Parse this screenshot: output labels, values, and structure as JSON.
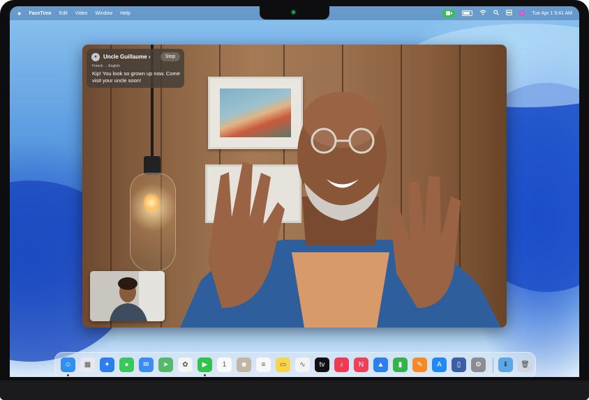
{
  "menubar": {
    "app_name": "FaceTime",
    "menus": [
      "Edit",
      "Video",
      "Window",
      "Help"
    ],
    "datetime": "Tue Apr 1  9:41 AM"
  },
  "caption": {
    "caller": "Uncle Guillaume ›",
    "stop_label": "Stop",
    "translation": "French → English",
    "message": "Kip! You look so grown up now. Come visit your uncle soon!"
  },
  "colors": {
    "accent_green": "#33c24d"
  },
  "dock": {
    "icons": [
      {
        "name": "finder-icon",
        "color": "#2f8ff5",
        "glyph": "☺"
      },
      {
        "name": "launchpad-icon",
        "color": "#e8e8ee",
        "glyph": "▦"
      },
      {
        "name": "safari-icon",
        "color": "#2a7ef0",
        "glyph": "✦"
      },
      {
        "name": "messages-icon",
        "color": "#38c759",
        "glyph": "●"
      },
      {
        "name": "mail-icon",
        "color": "#3b8cf5",
        "glyph": "✉"
      },
      {
        "name": "maps-icon",
        "color": "#55b86a",
        "glyph": "➤"
      },
      {
        "name": "photos-icon",
        "color": "#f4f4f4",
        "glyph": "✿"
      },
      {
        "name": "facetime-icon",
        "color": "#30c24a",
        "glyph": "▶"
      },
      {
        "name": "calendar-icon",
        "color": "#fafafa",
        "glyph": "1"
      },
      {
        "name": "contacts-icon",
        "color": "#bfb6a8",
        "glyph": "☻"
      },
      {
        "name": "reminders-icon",
        "color": "#f8f8f8",
        "glyph": "≡"
      },
      {
        "name": "notes-icon",
        "color": "#f7d44a",
        "glyph": "▭"
      },
      {
        "name": "freeform-icon",
        "color": "#f3f3f3",
        "glyph": "∿"
      },
      {
        "name": "apple-tv-icon",
        "color": "#111111",
        "glyph": "tv"
      },
      {
        "name": "music-icon",
        "color": "#f03a52",
        "glyph": "♪"
      },
      {
        "name": "news-icon",
        "color": "#f04055",
        "glyph": "N"
      },
      {
        "name": "keynote-icon",
        "color": "#2e7ef0",
        "glyph": "▲"
      },
      {
        "name": "numbers-icon",
        "color": "#33b44a",
        "glyph": "▮"
      },
      {
        "name": "pages-icon",
        "color": "#f58a24",
        "glyph": "✎"
      },
      {
        "name": "app-store-icon",
        "color": "#1f8af5",
        "glyph": "A"
      },
      {
        "name": "iphone-mirroring-icon",
        "color": "#3a5ea8",
        "glyph": "▯"
      },
      {
        "name": "system-settings-icon",
        "color": "#8c8c93",
        "glyph": "⚙"
      }
    ],
    "trailing": [
      {
        "name": "downloads-folder-icon",
        "color": "#5aa8e8",
        "glyph": "⬇"
      },
      {
        "name": "trash-icon",
        "color": "#cfd6df",
        "glyph": "🗑"
      }
    ]
  }
}
